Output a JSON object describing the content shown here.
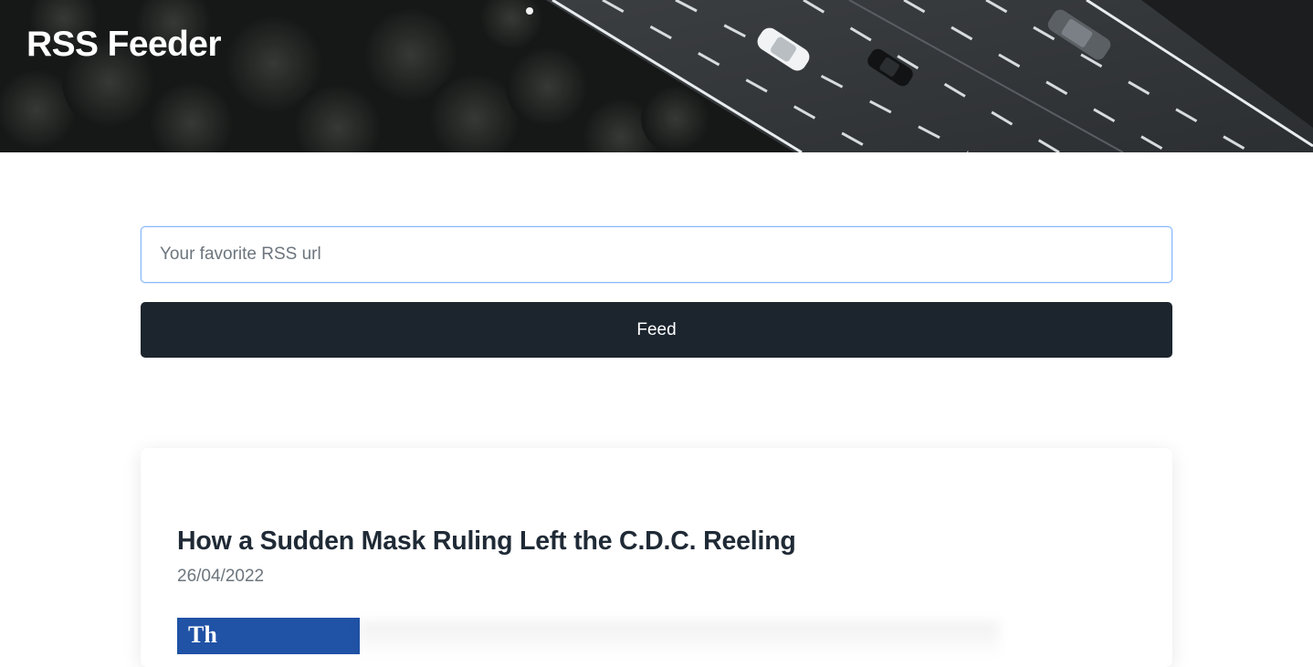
{
  "header": {
    "title": "RSS Feeder",
    "background_image": "aerial highway photo"
  },
  "form": {
    "url_placeholder": "Your favorite RSS url",
    "url_value": "",
    "submit_label": "Feed"
  },
  "feed": {
    "items": [
      {
        "title": "How a Sudden Mask Ruling Left the C.D.C. Reeling",
        "date": "26/04/2022",
        "image_partial_text": "Th"
      }
    ]
  },
  "colors": {
    "button_bg": "#1c252e",
    "input_border": "#86b7fe",
    "title_text": "#1f2a36",
    "muted_text": "#6c757d",
    "thumbnail_blue": "#2052a6"
  }
}
